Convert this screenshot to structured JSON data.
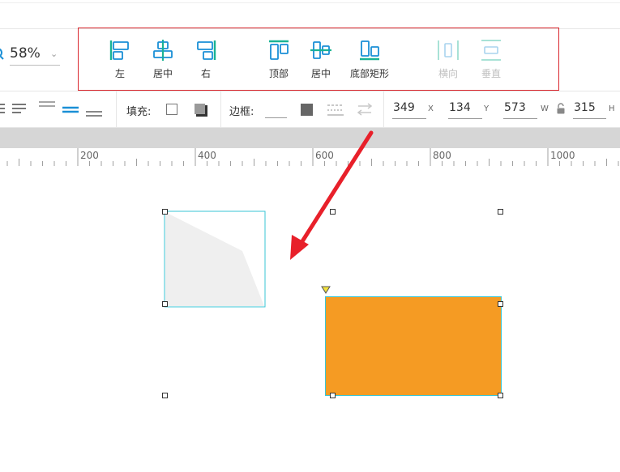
{
  "zoom": {
    "value": "58%"
  },
  "align": {
    "left": "左",
    "center_h": "居中",
    "right": "右",
    "top": "顶部",
    "center_v": "居中",
    "bottom": "底部矩形",
    "distribute_h": "横向",
    "distribute_v": "垂直"
  },
  "format": {
    "fill_label": "填充:",
    "border_label": "边框:"
  },
  "geometry": {
    "x_value": "349",
    "x_unit": "X",
    "y_value": "134",
    "y_unit": "Y",
    "w_value": "573",
    "w_unit": "W",
    "h_value": "315",
    "h_unit": "H"
  },
  "ruler": {
    "labels": [
      "200",
      "400",
      "600",
      "800",
      "1000"
    ]
  },
  "colors": {
    "accent": "#1ab394",
    "highlight_border": "#d9272e",
    "arrow": "#e8202a",
    "rect_fill": "#f59b23",
    "selection": "#39c6d6"
  }
}
